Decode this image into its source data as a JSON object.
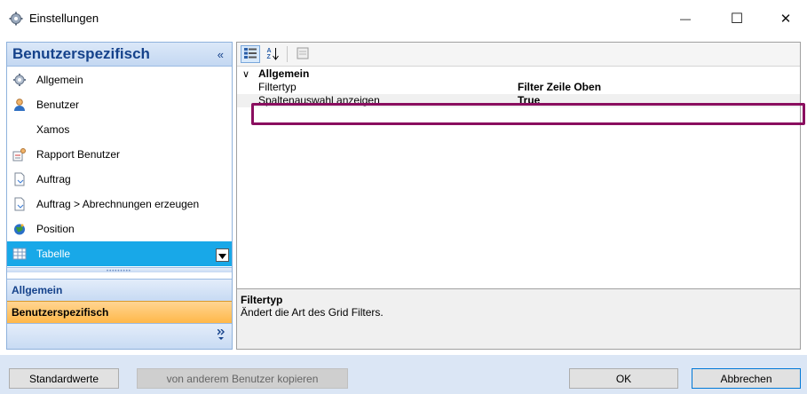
{
  "window": {
    "title": "Einstellungen",
    "controls": {
      "minimize": "—",
      "maximize": "☐",
      "close": "✕"
    }
  },
  "left_panel": {
    "header": "Benutzerspezifisch",
    "collapse_glyph": "«",
    "items": [
      {
        "label": "Allgemein",
        "icon": "gear-icon"
      },
      {
        "label": "Benutzer",
        "icon": "user-icon"
      },
      {
        "label": "Xamos",
        "icon": ""
      },
      {
        "label": "Rapport Benutzer",
        "icon": "report-user-icon"
      },
      {
        "label": "Auftrag",
        "icon": "document-icon"
      },
      {
        "label": "Auftrag > Abrechnungen erzeugen",
        "icon": "document-icon"
      },
      {
        "label": "Position",
        "icon": "globe-icon"
      },
      {
        "label": "Tabelle",
        "icon": "table-icon",
        "selected": true
      }
    ],
    "groups": [
      {
        "label": "Allgemein"
      },
      {
        "label": "Benutzerspezifisch",
        "active": true
      }
    ],
    "more_glyph": "»"
  },
  "property_grid": {
    "toolbar": [
      "categorized-view-icon",
      "sort-alpha-icon",
      "property-pages-icon"
    ],
    "sort_label": "AZ",
    "category": {
      "label": "Allgemein",
      "chevron": "∨"
    },
    "rows": [
      {
        "name": "Filtertyp",
        "value": "Filter Zeile Oben"
      },
      {
        "name": "Spaltenauswahl anzeigen",
        "value": "True",
        "selected": true
      }
    ],
    "description": {
      "title": "Filtertyp",
      "text": "Ändert die Art des Grid Filters."
    }
  },
  "buttons": {
    "defaults": "Standardwerte",
    "copy_from_user": "von anderem Benutzer kopieren",
    "ok": "OK",
    "cancel": "Abbrechen"
  },
  "colors": {
    "selection": "#18a8e8",
    "highlight_frame": "#8a0e5f",
    "header_text": "#15428b",
    "active_group": "#ffb849"
  }
}
